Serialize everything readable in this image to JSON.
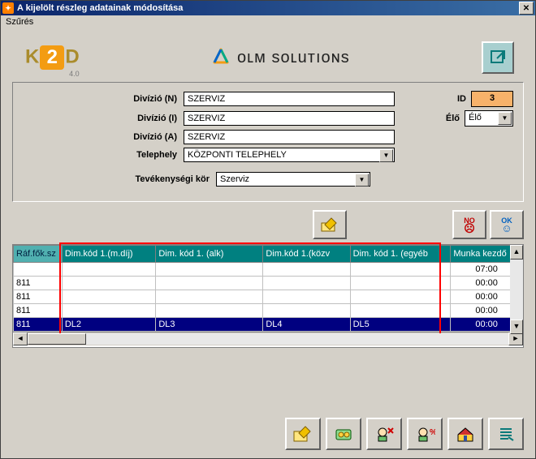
{
  "window": {
    "title": "A kijelölt részleg adatainak módosítása"
  },
  "menu": {
    "szures": "Szűrés"
  },
  "logos": {
    "k2d_text_k": "K",
    "k2d_text_2": "2",
    "k2d_text_d": "D",
    "k2d_version": "4.0",
    "dlm_text": "oʟᴍ ѕoʟuтıoɴѕ"
  },
  "form": {
    "divizio_n_label": "Divízió (N)",
    "divizio_n_value": "SZERVIZ",
    "divizio_i_label": "Divízió (I)",
    "divizio_i_value": "SZERVIZ",
    "divizio_a_label": "Divízió (A)",
    "divizio_a_value": "SZERVIZ",
    "telephely_label": "Telephely",
    "telephely_value": "KÖZPONTI TELEPHELY",
    "tevekenyseg_label": "Tevékenységi kör",
    "tevekenyseg_value": "Szerviz",
    "id_label": "ID",
    "id_value": "3",
    "elo_label": "Élő",
    "elo_value": "Élő"
  },
  "buttons": {
    "no": "NO",
    "ok": "OK"
  },
  "grid": {
    "headers": {
      "c0": "Ráf.fők.sz",
      "c1": "Dim.kód 1.(m.díj)",
      "c2": "Dim. kód 1. (alk)",
      "c3": "Dim.kód 1.(közv",
      "c4": "Dim. kód 1. (egyéb",
      "c5": "Munka kezdő"
    },
    "rows": [
      {
        "c0": "",
        "c1": "",
        "c2": "",
        "c3": "",
        "c4": "",
        "c5": "07:00"
      },
      {
        "c0": "811",
        "c1": "",
        "c2": "",
        "c3": "",
        "c4": "",
        "c5": "00:00"
      },
      {
        "c0": "811",
        "c1": "",
        "c2": "",
        "c3": "",
        "c4": "",
        "c5": "00:00"
      },
      {
        "c0": "811",
        "c1": "",
        "c2": "",
        "c3": "",
        "c4": "",
        "c5": "00:00"
      },
      {
        "c0": "811",
        "c1": "DL2",
        "c2": "DL3",
        "c3": "DL4",
        "c4": "DL5",
        "c5": "00:00"
      }
    ]
  }
}
